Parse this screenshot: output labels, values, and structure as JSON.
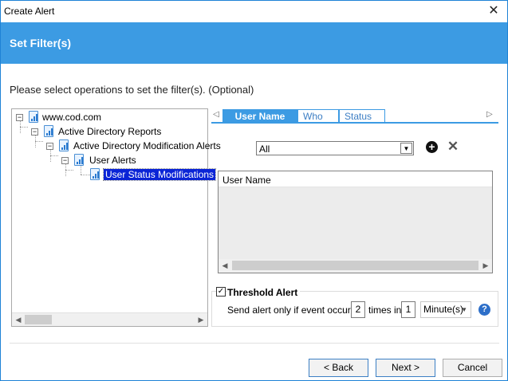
{
  "window": {
    "title": "Create Alert"
  },
  "banner": {
    "title": "Set Filter(s)"
  },
  "instruction": "Please select operations to set the filter(s). (Optional)",
  "tree": {
    "nodes": [
      {
        "label": "www.cod.com",
        "expander": "−"
      },
      {
        "label": "Active Directory Reports",
        "expander": "−"
      },
      {
        "label": "Active Directory Modification Alerts",
        "expander": "−"
      },
      {
        "label": "User Alerts",
        "expander": "−"
      },
      {
        "label": "User Status Modifications",
        "selected": true
      }
    ]
  },
  "tabs": [
    {
      "label": "User Name",
      "active": true
    },
    {
      "label": "Who"
    },
    {
      "label": "Status"
    }
  ],
  "filter": {
    "selected": "All",
    "list_header": "User Name"
  },
  "threshold": {
    "label": "Threshold Alert",
    "checked": true,
    "send_text": "Send alert only if event occurs",
    "count": "2",
    "times_in": "times in",
    "interval": "1",
    "unit": "Minute(s)"
  },
  "buttons": {
    "back": "< Back",
    "next": "Next >",
    "cancel": "Cancel"
  },
  "icons": {
    "close": "close-icon",
    "add": "plus-circle-icon",
    "remove": "x-icon",
    "help": "question-icon"
  },
  "colors": {
    "accent": "#3c9be3",
    "selection": "#0a24d6"
  }
}
